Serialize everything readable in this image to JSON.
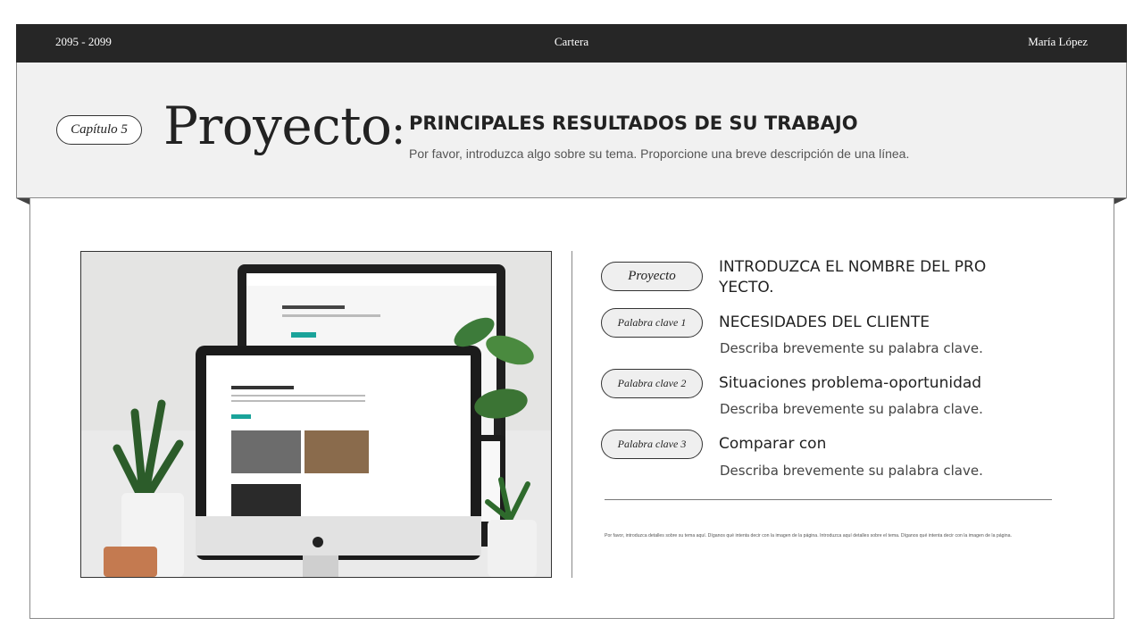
{
  "topbar": {
    "years": "2095 - 2099",
    "center": "Cartera",
    "author": "María López"
  },
  "header": {
    "chapter": "Capítulo 5",
    "title": "Proyecto",
    "colon": ":",
    "subtitle": "PRINCIPALES RESULTADOS DE SU TRABAJO",
    "description": "Por favor, introduzca algo sobre su tema. Proporcione una breve descripción de una línea."
  },
  "items": [
    {
      "pill": "Proyecto",
      "title": "INTRODUZCA EL NOMBRE DEL PRO YECTO.",
      "desc": ""
    },
    {
      "pill": "Palabra clave 1",
      "title": "NECESIDADES DEL CLIENTE",
      "desc": "Describa brevemente su palabra clave."
    },
    {
      "pill": "Palabra clave 2",
      "title": "Situaciones problema-oportunidad",
      "desc": "Describa brevemente su palabra clave."
    },
    {
      "pill": "Palabra clave 3",
      "title": "Comparar con",
      "desc": "Describa brevemente su palabra clave."
    }
  ],
  "footnote": "Por favor, introduzca detalles sobre su tema aquí. Díganos qué intenta decir con la imagen de la página. Introduzca aquí detalles sobre el tema. Díganos qué intenta decir con la imagen de la página.",
  "icons": {
    "photo": "computer-monitors-plants-image"
  }
}
